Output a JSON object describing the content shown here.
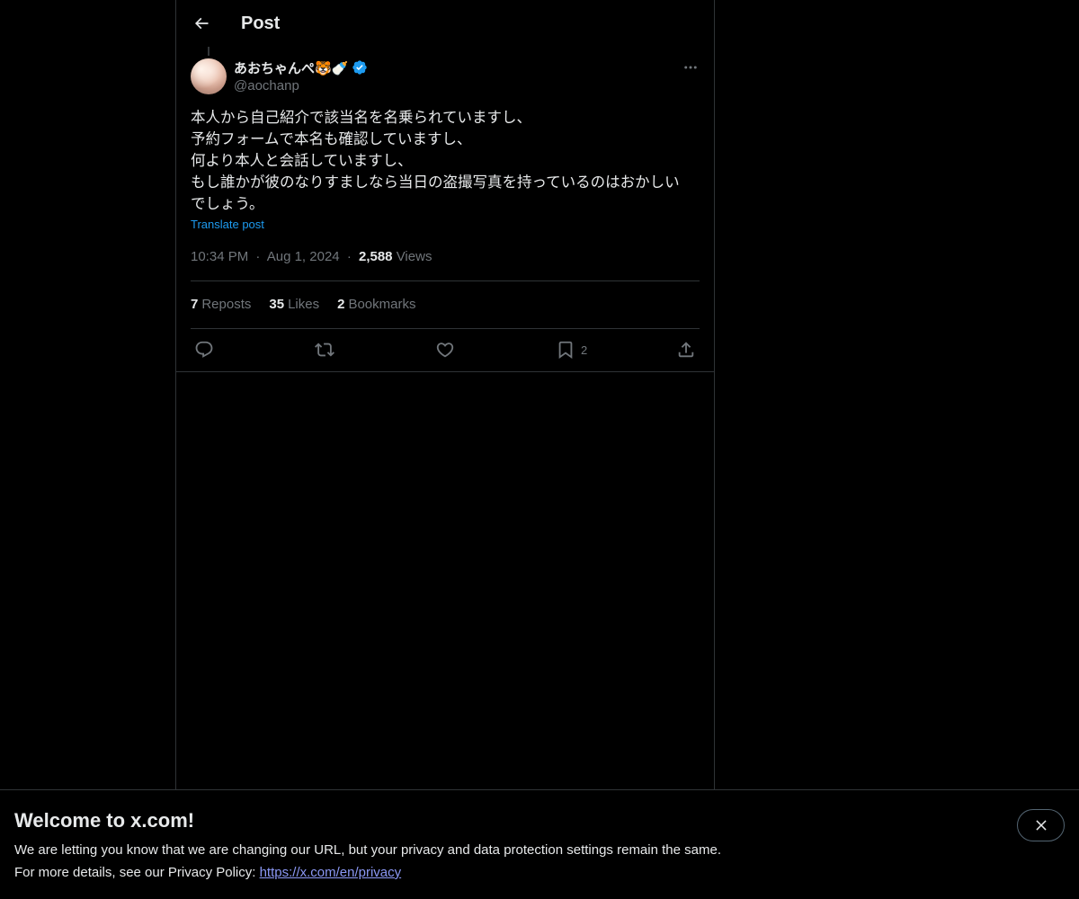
{
  "header": {
    "title": "Post",
    "back_icon": "arrow-left-icon"
  },
  "post": {
    "author": {
      "display_name": "あおちゃんぺ🐯🍼",
      "handle": "@aochanp",
      "verified": true,
      "verified_color": "#1d9bf0"
    },
    "text_lines": [
      "本人から自己紹介で該当名を名乗られていますし、",
      "予約フォームで本名も確認していますし、",
      "何より本人と会話していますし、",
      "もし誰かが彼のなりすましなら当日の盗撮写真を持っているのはおかしい",
      "でしょう。"
    ],
    "translate_label": "Translate post",
    "time": "10:34 PM",
    "date": "Aug 1, 2024",
    "separator": "·",
    "views_count": "2,588",
    "views_label": "Views",
    "stats": {
      "reposts_count": "7",
      "reposts_label": "Reposts",
      "likes_count": "35",
      "likes_label": "Likes",
      "bookmarks_count": "2",
      "bookmarks_label": "Bookmarks"
    },
    "actions": {
      "reply_icon": "reply-icon",
      "repost_icon": "repost-icon",
      "like_icon": "heart-icon",
      "bookmark_icon": "bookmark-icon",
      "bookmark_count": "2",
      "share_icon": "share-icon"
    }
  },
  "banner": {
    "title": "Welcome to x.com!",
    "line1": "We are letting you know that we are changing our URL, but your privacy and data protection settings remain the same.",
    "line2_prefix": "For more details, see our Privacy Policy: ",
    "link_text": "https://x.com/en/privacy",
    "close_icon": "close-icon"
  },
  "colors": {
    "background": "#000000",
    "text": "#e7e9ea",
    "muted": "#71767b",
    "accent": "#1d9bf0",
    "border": "#2f3336"
  }
}
